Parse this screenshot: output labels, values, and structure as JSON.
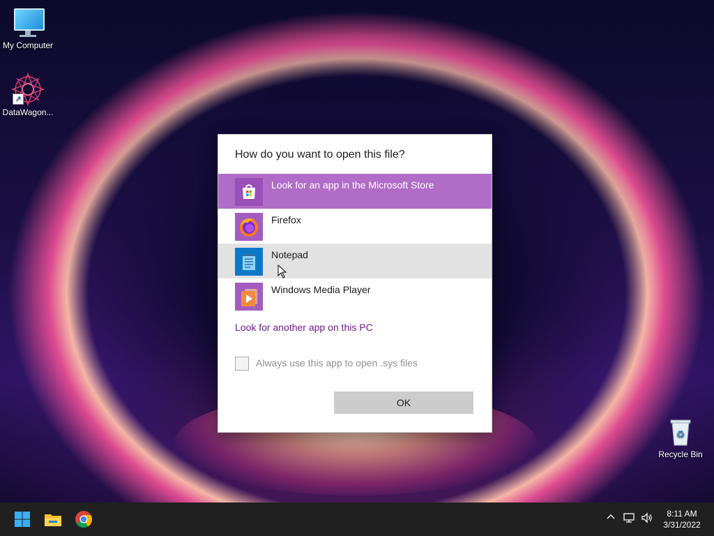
{
  "desktop": {
    "icons": [
      {
        "label": "My Computer"
      },
      {
        "label": "DataWagon..."
      },
      {
        "label": "Recycle Bin"
      }
    ]
  },
  "dialog": {
    "title": "How do you want to open this file?",
    "apps": [
      {
        "label": "Look for an app in the Microsoft Store",
        "icon": "store-icon",
        "state": "selected"
      },
      {
        "label": "Firefox",
        "icon": "firefox-icon",
        "state": "normal"
      },
      {
        "label": "Notepad",
        "icon": "notepad-icon",
        "state": "hover"
      },
      {
        "label": "Windows Media Player",
        "icon": "media-player-icon",
        "state": "normal"
      }
    ],
    "another_app_link": "Look for another app on this PC",
    "always_use_label": "Always use this app to open .sys files",
    "always_use_checked": false,
    "ok_label": "OK"
  },
  "taskbar": {
    "pinned": [
      "start-icon",
      "file-explorer-icon",
      "chrome-icon"
    ],
    "tray": [
      "chevron-up-icon",
      "network-icon",
      "volume-icon"
    ],
    "clock": {
      "time": "8:11 AM",
      "date": "3/31/2022"
    }
  },
  "colors": {
    "accent": "#b06cc6",
    "link": "#6e1b8c",
    "hover_row": "#e2e2e2",
    "ok_button": "#cccccc",
    "taskbar": "#202020"
  }
}
